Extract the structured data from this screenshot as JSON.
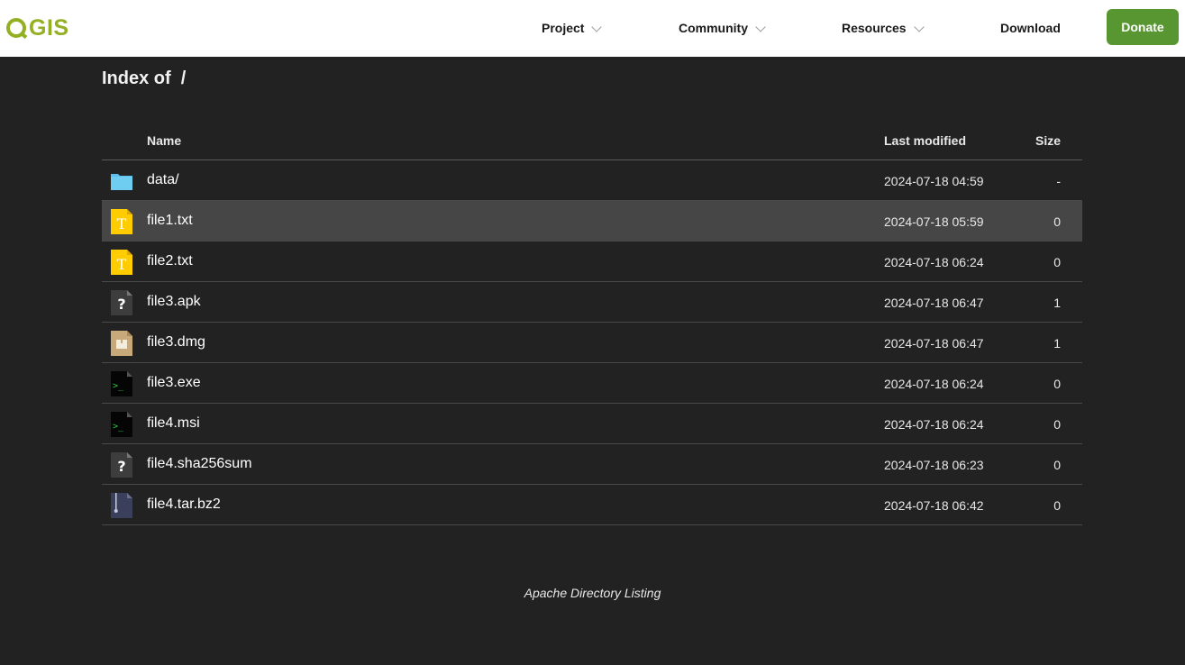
{
  "header": {
    "logo_text": "GIS",
    "nav": [
      {
        "label": "Project"
      },
      {
        "label": "Community"
      },
      {
        "label": "Resources"
      },
      {
        "label": "Download"
      }
    ],
    "donate_label": "Donate",
    "colors": {
      "brand": "#93b023",
      "donate": "#589632"
    }
  },
  "page": {
    "title_prefix": "Index of",
    "path": "/"
  },
  "table": {
    "columns": {
      "name": "Name",
      "modified": "Last modified",
      "size": "Size"
    },
    "rows": [
      {
        "icon": "folder-icon",
        "name": "data/",
        "modified": "2024-07-18 04:59",
        "size": "-"
      },
      {
        "icon": "text-file-icon",
        "name": "file1.txt",
        "modified": "2024-07-18 05:59",
        "size": "0",
        "highlighted": true
      },
      {
        "icon": "text-file-icon",
        "name": "file2.txt",
        "modified": "2024-07-18 06:24",
        "size": "0"
      },
      {
        "icon": "unknown-file-icon",
        "name": "file3.apk",
        "modified": "2024-07-18 06:47",
        "size": "1"
      },
      {
        "icon": "package-file-icon",
        "name": "file3.dmg",
        "modified": "2024-07-18 06:47",
        "size": "1"
      },
      {
        "icon": "executable-file-icon",
        "name": "file3.exe",
        "modified": "2024-07-18 06:24",
        "size": "0"
      },
      {
        "icon": "executable-file-icon",
        "name": "file4.msi",
        "modified": "2024-07-18 06:24",
        "size": "0"
      },
      {
        "icon": "unknown-file-icon",
        "name": "file4.sha256sum",
        "modified": "2024-07-18 06:23",
        "size": "0"
      },
      {
        "icon": "archive-file-icon",
        "name": "file4.tar.bz2",
        "modified": "2024-07-18 06:42",
        "size": "0"
      }
    ]
  },
  "footer": {
    "text": "Apache Directory Listing"
  }
}
